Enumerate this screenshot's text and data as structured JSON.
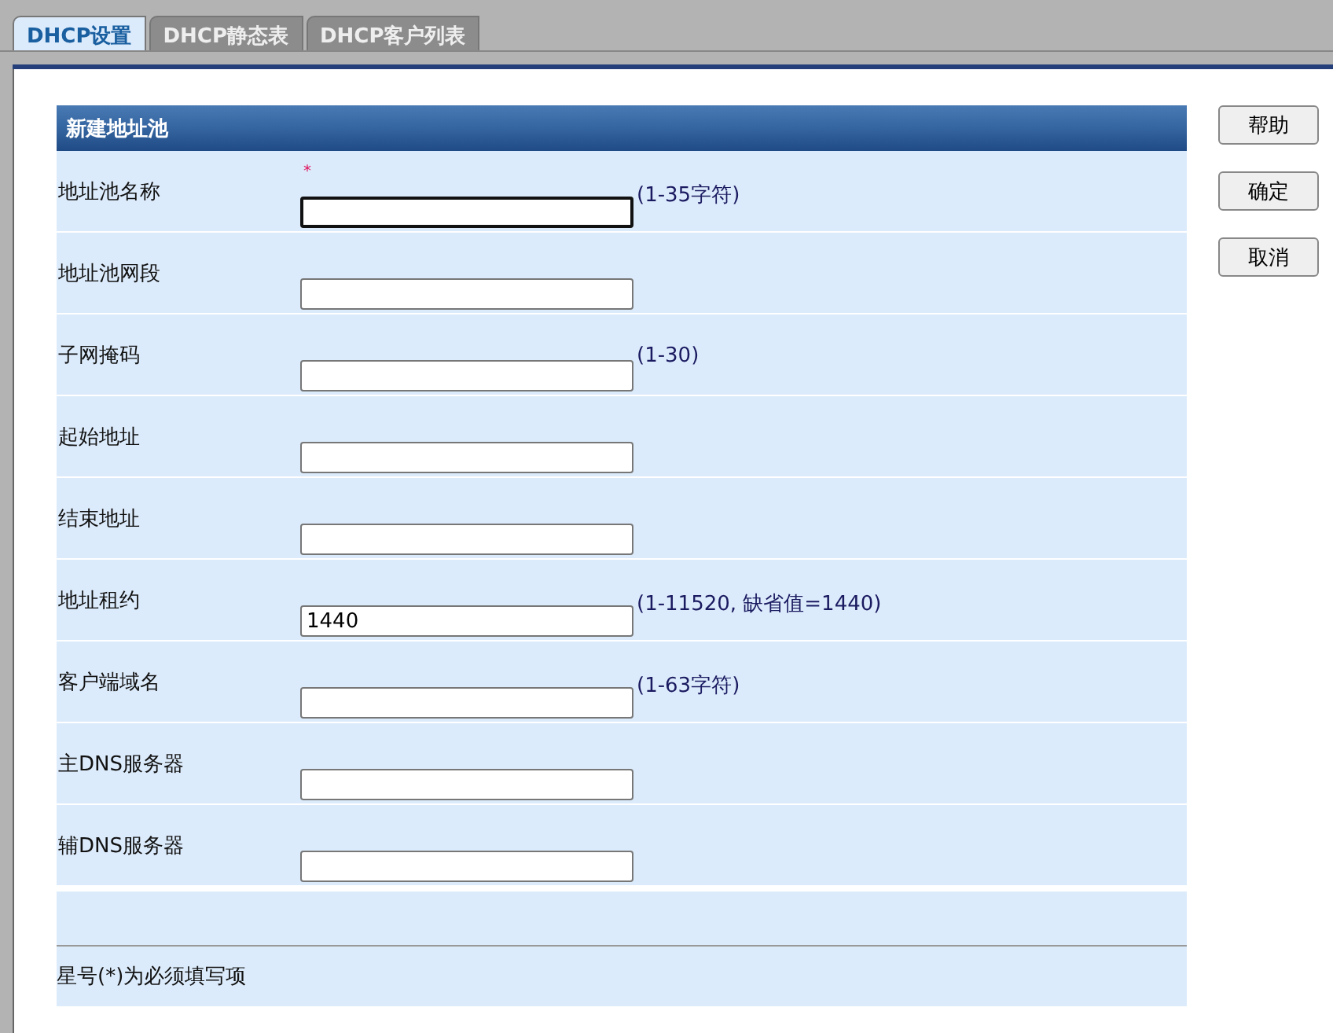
{
  "tabs": [
    {
      "label": "DHCP设置",
      "selected": true
    },
    {
      "label": "DHCP静态表",
      "selected": false
    },
    {
      "label": "DHCP客户列表",
      "selected": false
    }
  ],
  "form": {
    "title": "新建地址池",
    "fields": [
      {
        "label": "地址池名称",
        "required": true,
        "hint": "(1-35字符)",
        "focused": true
      },
      {
        "label": "地址池网段",
        "required": false,
        "focused": false
      },
      {
        "label": "子网掩码",
        "required": false,
        "hint": "(1-30)",
        "focused": false
      },
      {
        "label": "起始地址",
        "required": false,
        "focused": false
      },
      {
        "label": "结束地址",
        "required": false,
        "focused": false
      },
      {
        "label": "地址租约",
        "required": false,
        "value": "1440",
        "hint": "(1-11520, 缺省值=1440)",
        "focused": false
      },
      {
        "label": "客户端域名",
        "required": false,
        "hint": "(1-63字符)",
        "focused": false
      },
      {
        "label": "主DNS服务器",
        "required": false,
        "focused": false
      },
      {
        "label": "辅DNS服务器",
        "required": false,
        "focused": false
      }
    ],
    "required_mark": "*",
    "footnote": "星号(*)为必须填写项"
  },
  "buttons": [
    "帮助",
    "确定",
    "取消"
  ]
}
